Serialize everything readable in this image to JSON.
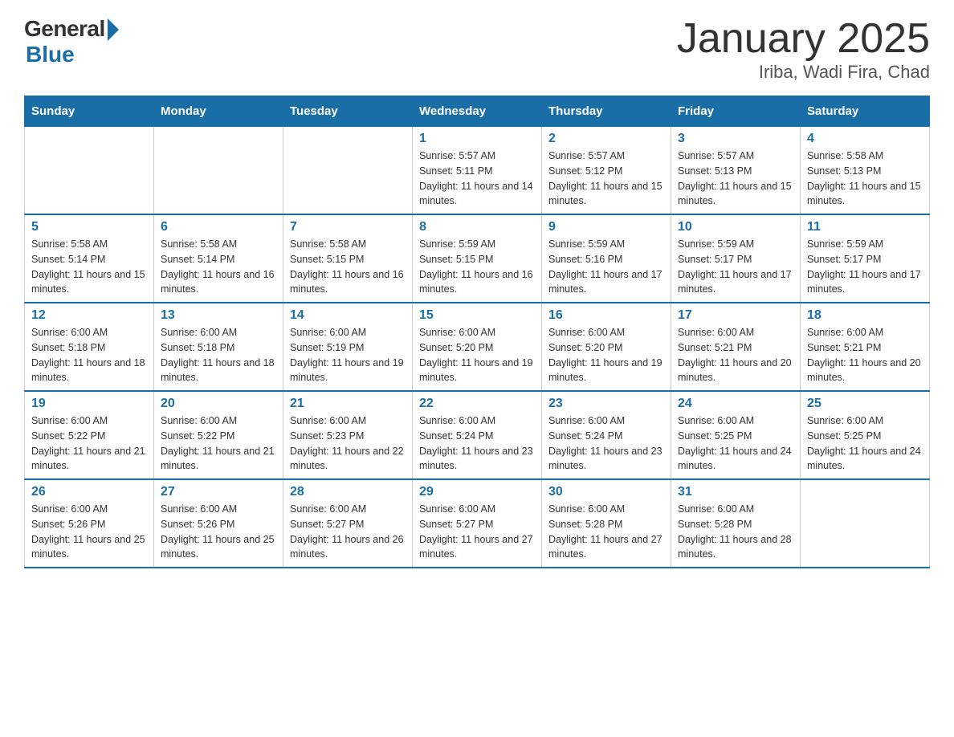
{
  "logo": {
    "general": "General",
    "blue": "Blue"
  },
  "title": "January 2025",
  "subtitle": "Iriba, Wadi Fira, Chad",
  "days_of_week": [
    "Sunday",
    "Monday",
    "Tuesday",
    "Wednesday",
    "Thursday",
    "Friday",
    "Saturday"
  ],
  "weeks": [
    [
      {
        "day": "",
        "info": ""
      },
      {
        "day": "",
        "info": ""
      },
      {
        "day": "",
        "info": ""
      },
      {
        "day": "1",
        "info": "Sunrise: 5:57 AM\nSunset: 5:11 PM\nDaylight: 11 hours and 14 minutes."
      },
      {
        "day": "2",
        "info": "Sunrise: 5:57 AM\nSunset: 5:12 PM\nDaylight: 11 hours and 15 minutes."
      },
      {
        "day": "3",
        "info": "Sunrise: 5:57 AM\nSunset: 5:13 PM\nDaylight: 11 hours and 15 minutes."
      },
      {
        "day": "4",
        "info": "Sunrise: 5:58 AM\nSunset: 5:13 PM\nDaylight: 11 hours and 15 minutes."
      }
    ],
    [
      {
        "day": "5",
        "info": "Sunrise: 5:58 AM\nSunset: 5:14 PM\nDaylight: 11 hours and 15 minutes."
      },
      {
        "day": "6",
        "info": "Sunrise: 5:58 AM\nSunset: 5:14 PM\nDaylight: 11 hours and 16 minutes."
      },
      {
        "day": "7",
        "info": "Sunrise: 5:58 AM\nSunset: 5:15 PM\nDaylight: 11 hours and 16 minutes."
      },
      {
        "day": "8",
        "info": "Sunrise: 5:59 AM\nSunset: 5:15 PM\nDaylight: 11 hours and 16 minutes."
      },
      {
        "day": "9",
        "info": "Sunrise: 5:59 AM\nSunset: 5:16 PM\nDaylight: 11 hours and 17 minutes."
      },
      {
        "day": "10",
        "info": "Sunrise: 5:59 AM\nSunset: 5:17 PM\nDaylight: 11 hours and 17 minutes."
      },
      {
        "day": "11",
        "info": "Sunrise: 5:59 AM\nSunset: 5:17 PM\nDaylight: 11 hours and 17 minutes."
      }
    ],
    [
      {
        "day": "12",
        "info": "Sunrise: 6:00 AM\nSunset: 5:18 PM\nDaylight: 11 hours and 18 minutes."
      },
      {
        "day": "13",
        "info": "Sunrise: 6:00 AM\nSunset: 5:18 PM\nDaylight: 11 hours and 18 minutes."
      },
      {
        "day": "14",
        "info": "Sunrise: 6:00 AM\nSunset: 5:19 PM\nDaylight: 11 hours and 19 minutes."
      },
      {
        "day": "15",
        "info": "Sunrise: 6:00 AM\nSunset: 5:20 PM\nDaylight: 11 hours and 19 minutes."
      },
      {
        "day": "16",
        "info": "Sunrise: 6:00 AM\nSunset: 5:20 PM\nDaylight: 11 hours and 19 minutes."
      },
      {
        "day": "17",
        "info": "Sunrise: 6:00 AM\nSunset: 5:21 PM\nDaylight: 11 hours and 20 minutes."
      },
      {
        "day": "18",
        "info": "Sunrise: 6:00 AM\nSunset: 5:21 PM\nDaylight: 11 hours and 20 minutes."
      }
    ],
    [
      {
        "day": "19",
        "info": "Sunrise: 6:00 AM\nSunset: 5:22 PM\nDaylight: 11 hours and 21 minutes."
      },
      {
        "day": "20",
        "info": "Sunrise: 6:00 AM\nSunset: 5:22 PM\nDaylight: 11 hours and 21 minutes."
      },
      {
        "day": "21",
        "info": "Sunrise: 6:00 AM\nSunset: 5:23 PM\nDaylight: 11 hours and 22 minutes."
      },
      {
        "day": "22",
        "info": "Sunrise: 6:00 AM\nSunset: 5:24 PM\nDaylight: 11 hours and 23 minutes."
      },
      {
        "day": "23",
        "info": "Sunrise: 6:00 AM\nSunset: 5:24 PM\nDaylight: 11 hours and 23 minutes."
      },
      {
        "day": "24",
        "info": "Sunrise: 6:00 AM\nSunset: 5:25 PM\nDaylight: 11 hours and 24 minutes."
      },
      {
        "day": "25",
        "info": "Sunrise: 6:00 AM\nSunset: 5:25 PM\nDaylight: 11 hours and 24 minutes."
      }
    ],
    [
      {
        "day": "26",
        "info": "Sunrise: 6:00 AM\nSunset: 5:26 PM\nDaylight: 11 hours and 25 minutes."
      },
      {
        "day": "27",
        "info": "Sunrise: 6:00 AM\nSunset: 5:26 PM\nDaylight: 11 hours and 25 minutes."
      },
      {
        "day": "28",
        "info": "Sunrise: 6:00 AM\nSunset: 5:27 PM\nDaylight: 11 hours and 26 minutes."
      },
      {
        "day": "29",
        "info": "Sunrise: 6:00 AM\nSunset: 5:27 PM\nDaylight: 11 hours and 27 minutes."
      },
      {
        "day": "30",
        "info": "Sunrise: 6:00 AM\nSunset: 5:28 PM\nDaylight: 11 hours and 27 minutes."
      },
      {
        "day": "31",
        "info": "Sunrise: 6:00 AM\nSunset: 5:28 PM\nDaylight: 11 hours and 28 minutes."
      },
      {
        "day": "",
        "info": ""
      }
    ]
  ]
}
